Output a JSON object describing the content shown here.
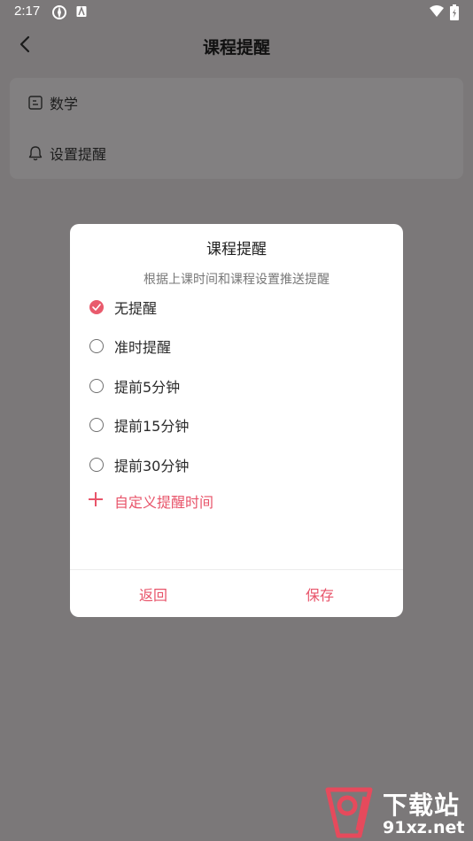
{
  "status_bar": {
    "time": "2:17",
    "icons": [
      "wind-icon",
      "a-badge-icon",
      "wifi-icon",
      "battery-charging-icon"
    ]
  },
  "header": {
    "title": "课程提醒",
    "back_icon": "chevron-left-icon"
  },
  "course_card": {
    "rows": [
      {
        "icon": "course-icon",
        "label": "数学"
      },
      {
        "icon": "bell-icon",
        "label": "设置提醒"
      }
    ]
  },
  "dialog": {
    "title": "课程提醒",
    "subtitle": "根据上课时间和课程设置推送提醒",
    "options": [
      {
        "label": "无提醒",
        "checked": true
      },
      {
        "label": "准时提醒",
        "checked": false
      },
      {
        "label": "提前5分钟",
        "checked": false
      },
      {
        "label": "提前15分钟",
        "checked": false
      },
      {
        "label": "提前30分钟",
        "checked": false
      }
    ],
    "custom_label": "自定义提醒时间",
    "buttons": {
      "back": "返回",
      "save": "保存"
    }
  },
  "watermark": {
    "text_top": "下载站",
    "text_bottom": "91xz.net"
  },
  "colors": {
    "overlay_bg": "#7b7879",
    "accent": "#e8546a",
    "dialog_bg": "#ffffff"
  }
}
